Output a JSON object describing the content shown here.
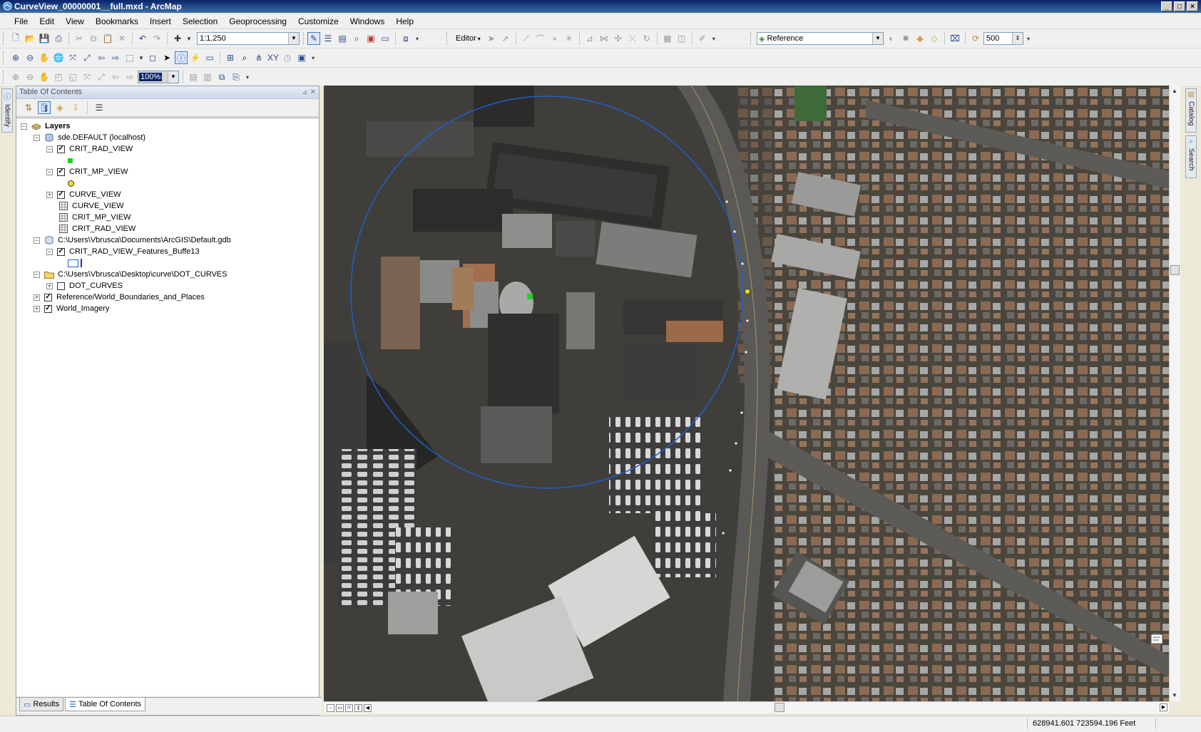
{
  "window": {
    "title": "CurveView_00000001__full.mxd - ArcMap",
    "controls": [
      "_",
      "□",
      "×"
    ]
  },
  "menu": [
    "File",
    "Edit",
    "View",
    "Bookmarks",
    "Insert",
    "Selection",
    "Geoprocessing",
    "Customize",
    "Windows",
    "Help"
  ],
  "toolbar": {
    "scale_value": "1:1,250",
    "editor_label": "Editor",
    "basemap_layer_value": "Reference",
    "transparency_value": "500",
    "zoom_percent": "100%"
  },
  "toc": {
    "title": "Table Of Contents",
    "tree": {
      "layers_label": "Layers",
      "sde_group": "sde.DEFAULT (localhost)",
      "crit_rad_view": "CRIT_RAD_VIEW",
      "crit_mp_view": "CRIT_MP_VIEW",
      "curve_view": "CURVE_VIEW",
      "table_curve_view": "CURVE_VIEW",
      "table_crit_mp_view": "CRIT_MP_VIEW",
      "table_crit_rad_view": "CRIT_RAD_VIEW",
      "gdb_group": "C:\\Users\\Vbrusca\\Documents\\ArcGIS\\Default.gdb",
      "buffer_layer": "CRIT_RAD_VIEW_Features_Buffe13",
      "folder_group": "C:\\Users\\Vbrusca\\Desktop\\curve\\DOT_CURVES",
      "dot_curves": "DOT_CURVES",
      "reference_layer": "Reference/World_Boundaries_and_Places",
      "imagery_layer": "World_Imagery"
    },
    "checked": {
      "crit_rad_view": true,
      "crit_mp_view": true,
      "curve_view": true,
      "buffer_layer": true,
      "dot_curves": false,
      "reference_layer": true,
      "imagery_layer": true
    },
    "tabs": {
      "results": "Results",
      "toc": "Table Of Contents"
    }
  },
  "side_tabs": {
    "left": "Identify",
    "right_top": "Catalog",
    "right_bottom": "Search"
  },
  "status": {
    "coordinates": "628941.601  723594.196 Feet"
  },
  "colors": {
    "accent": "#0a246a",
    "buffer_circle": "#1f5fd0",
    "rad_point": "#22d022",
    "mp_point": "#f0e020"
  }
}
